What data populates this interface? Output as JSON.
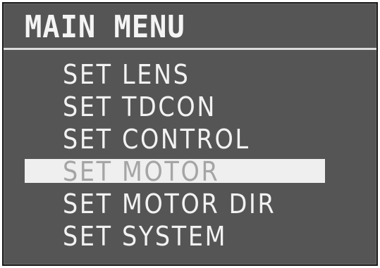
{
  "menu": {
    "title": "MAIN MENU",
    "selected_index": 3,
    "items": [
      {
        "label": "SET LENS"
      },
      {
        "label": "SET TDCON"
      },
      {
        "label": "SET CONTROL"
      },
      {
        "label": "SET MOTOR"
      },
      {
        "label": "SET MOTOR DIR"
      },
      {
        "label": "SET SYSTEM"
      }
    ]
  },
  "colors": {
    "background": "#555555",
    "text": "#f2f2f2",
    "highlight": "#efefef",
    "highlight_text": "#a5a5a5"
  }
}
